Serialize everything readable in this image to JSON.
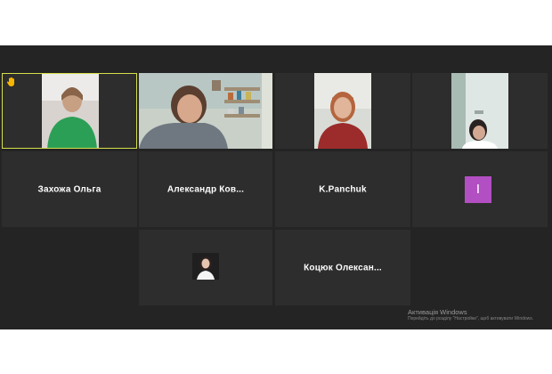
{
  "participants": [
    {
      "name": "",
      "hand_raised": true,
      "active_speaker": true
    },
    {
      "name": ""
    },
    {
      "name": ""
    },
    {
      "name": ""
    },
    {
      "name": "Захожа Ольга"
    },
    {
      "name": "Александр  Ков..."
    },
    {
      "name": "K.Panchuk"
    },
    {
      "name": "",
      "avatar_initial": "I",
      "avatar_color": "#b24fc2"
    },
    {
      "name": ""
    },
    {
      "name": "Коцюк  Олексан..."
    }
  ],
  "watermark": {
    "title": "Активація Windows",
    "subtitle": "Перейдіть до розділу \"Настройки\", щоб активувати Windows."
  },
  "colors": {
    "meeting_bg": "#242424",
    "tile_bg": "#2d2d2d",
    "active_border": "#d6df4a",
    "raise_hand": "#f7b500"
  }
}
